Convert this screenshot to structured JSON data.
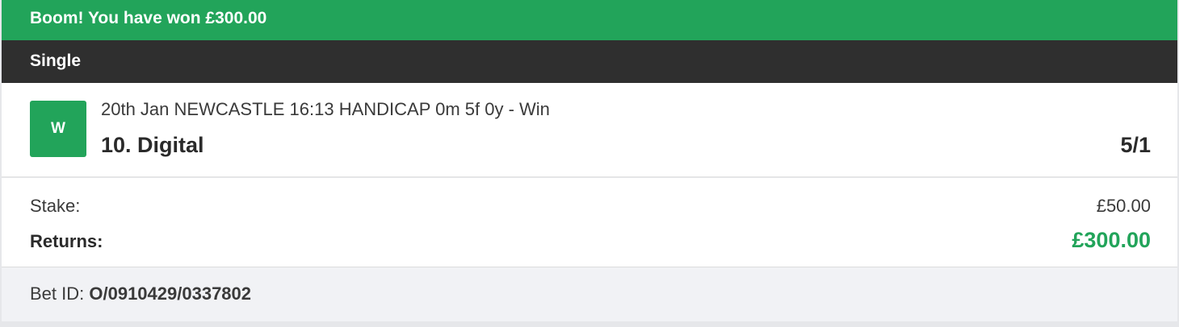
{
  "banner": {
    "message": "Boom! You have won £300.00",
    "color": "#22a45a"
  },
  "bet": {
    "type": "Single"
  },
  "selection": {
    "result_badge": "W",
    "market": "20th Jan NEWCASTLE 16:13 HANDICAP 0m 5f 0y - Win",
    "name": "10. Digital",
    "odds": "5/1"
  },
  "summary": {
    "stake_label": "Stake:",
    "stake_value": "£50.00",
    "returns_label": "Returns:",
    "returns_value": "£300.00"
  },
  "footer": {
    "bet_id_label": "Bet ID:",
    "bet_id_value": "O/0910429/0337802"
  }
}
